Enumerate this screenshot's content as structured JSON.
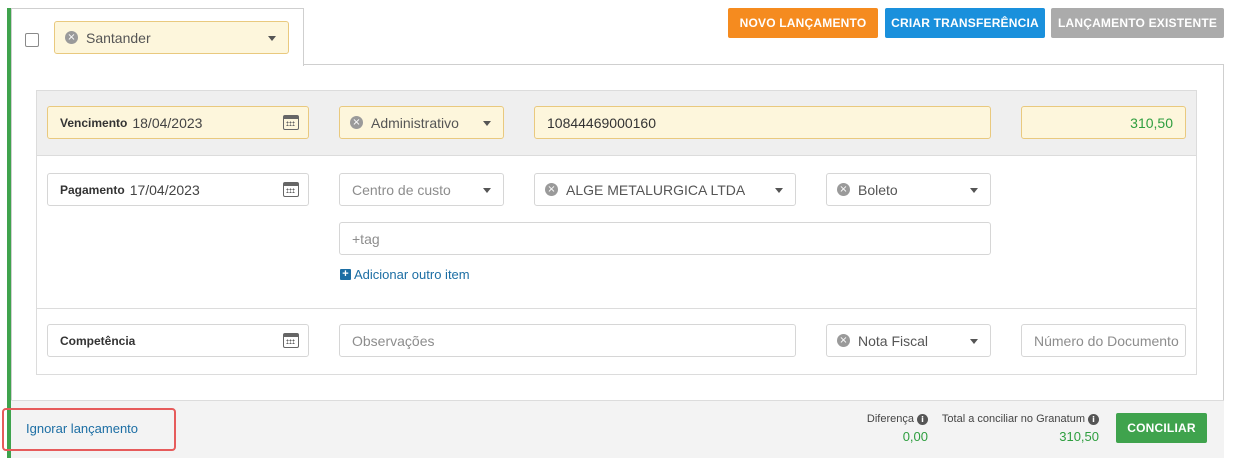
{
  "header": {
    "bank_select": {
      "value": "Santander"
    },
    "buttons": {
      "novo": "NOVO LANÇAMENTO",
      "transferencia": "CRIAR TRANSFERÊNCIA",
      "existente": "LANÇAMENTO EXISTENTE"
    }
  },
  "row1": {
    "vencimento_label": "Vencimento",
    "vencimento_value": "18/04/2023",
    "category": "Administrativo",
    "document": "10844469000160",
    "amount": "310,50"
  },
  "row2": {
    "pagamento_label": "Pagamento",
    "pagamento_value": "17/04/2023",
    "centro_custo_placeholder": "Centro de custo",
    "fornecedor": "ALGE METALURGICA LTDA",
    "forma_pagamento": "Boleto",
    "tag_placeholder": "+tag",
    "add_item": "Adicionar outro item"
  },
  "row3": {
    "competencia_label": "Competência",
    "observacoes_placeholder": "Observações",
    "tipo_documento": "Nota Fiscal",
    "numero_documento_placeholder": "Número do Documento"
  },
  "footer": {
    "ignore_link": "Ignorar lançamento",
    "diferenca_label": "Diferença",
    "diferenca_value": "0,00",
    "total_label": "Total a conciliar no Granatum",
    "total_value": "310,50",
    "conciliar": "CONCILIAR"
  },
  "colors": {
    "accent_green": "#3fa34d",
    "orange": "#f58b1f",
    "blue": "#1a90dc",
    "gray": "#ababab",
    "highlight_red": "#e65b5b"
  },
  "icons": [
    "clear-icon",
    "chevron-down-icon",
    "calendar-icon",
    "plus-icon",
    "info-icon"
  ]
}
